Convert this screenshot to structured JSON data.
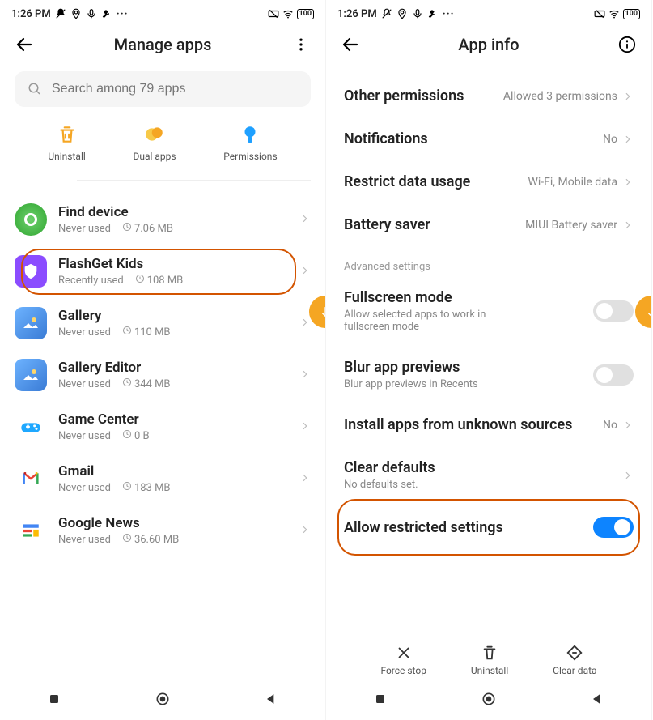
{
  "status": {
    "time": "1:26 PM",
    "battery": "100"
  },
  "left": {
    "title": "Manage apps",
    "search_placeholder": "Search among 79 apps",
    "tools": [
      {
        "name": "Uninstall"
      },
      {
        "name": "Dual apps"
      },
      {
        "name": "Permissions"
      }
    ],
    "apps": [
      {
        "name": "Find device",
        "usage": "Never used",
        "size": "7.06 MB",
        "icon": "find"
      },
      {
        "name": "FlashGet Kids",
        "usage": "Recently used",
        "size": "108 MB",
        "icon": "flash",
        "highlight": true
      },
      {
        "name": "Gallery",
        "usage": "Never used",
        "size": "110 MB",
        "icon": "gallery"
      },
      {
        "name": "Gallery Editor",
        "usage": "Never used",
        "size": "344 MB",
        "icon": "gallery"
      },
      {
        "name": "Game Center",
        "usage": "Never used",
        "size": "0 B",
        "icon": "game"
      },
      {
        "name": "Gmail",
        "usage": "Never used",
        "size": "183 MB",
        "icon": "gmail"
      },
      {
        "name": "Google News",
        "usage": "Never used",
        "size": "36.60 MB",
        "icon": "news"
      }
    ]
  },
  "right": {
    "title": "App info",
    "rows": [
      {
        "label": "Other permissions",
        "value": "Allowed 3 permissions",
        "chev": true
      },
      {
        "label": "Notifications",
        "value": "No",
        "chev": true
      },
      {
        "label": "Restrict data usage",
        "value": "Wi-Fi, Mobile data",
        "chev": true
      },
      {
        "label": "Battery saver",
        "value": "MIUI Battery saver",
        "chev": true
      }
    ],
    "section": "Advanced settings",
    "advanced": [
      {
        "label": "Fullscreen mode",
        "sub": "Allow selected apps to work in fullscreen mode",
        "toggle": false
      },
      {
        "label": "Blur app previews",
        "sub": "Blur app previews in Recents",
        "toggle": false
      },
      {
        "label": "Install apps from unknown sources",
        "value": "No",
        "chev": true
      },
      {
        "label": "Clear defaults",
        "sub": "No defaults set.",
        "chev": true
      },
      {
        "label": "Allow restricted settings",
        "toggle": true,
        "highlight": true
      }
    ],
    "actions": [
      {
        "name": "Force stop"
      },
      {
        "name": "Uninstall"
      },
      {
        "name": "Clear data"
      }
    ]
  }
}
